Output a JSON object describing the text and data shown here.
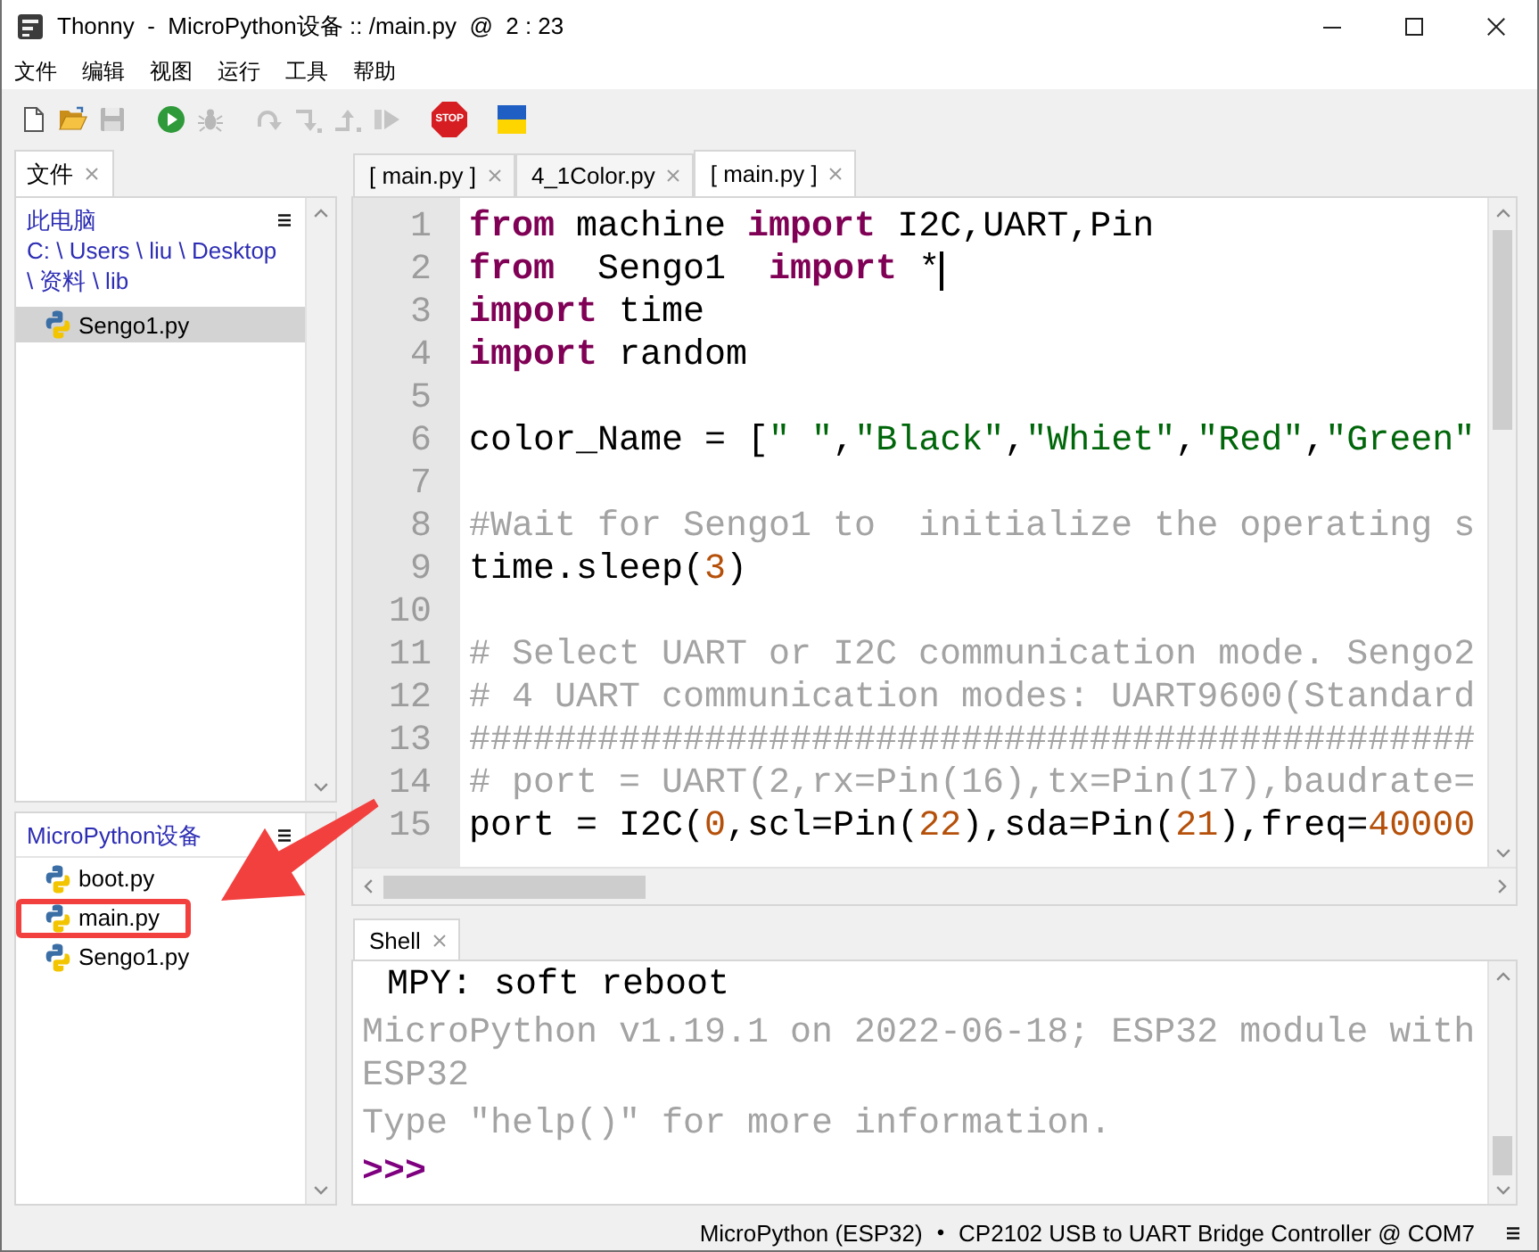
{
  "window": {
    "title": "Thonny  -  MicroPython设备 :: /main.py  @  2 : 23"
  },
  "menu": [
    "文件",
    "编辑",
    "视图",
    "运行",
    "工具",
    "帮助"
  ],
  "toolbar": [
    {
      "buttons": [
        {
          "kind": "new",
          "disabled": false
        },
        {
          "kind": "open",
          "disabled": false
        },
        {
          "kind": "save",
          "disabled": true
        }
      ]
    },
    {
      "buttons": [
        {
          "kind": "run",
          "disabled": false
        },
        {
          "kind": "debug",
          "disabled": true
        }
      ]
    },
    {
      "buttons": [
        {
          "kind": "step_over",
          "disabled": true
        },
        {
          "kind": "step_into",
          "disabled": true
        },
        {
          "kind": "step_out",
          "disabled": true
        },
        {
          "kind": "resume",
          "disabled": true
        }
      ]
    },
    {
      "buttons": [
        {
          "kind": "stop",
          "label": "STOP",
          "disabled": false
        }
      ]
    },
    {
      "buttons": [
        {
          "kind": "flag"
        }
      ]
    }
  ],
  "files_panel": {
    "tab": {
      "label": "文件",
      "selected": true
    },
    "local": {
      "title": "此电脑",
      "path": "C: \\ Users \\ liu \\ Desktop \\ 资料 \\ lib",
      "files": [
        {
          "name": "Sengo1.py",
          "selected": true
        }
      ]
    },
    "device": {
      "title": "MicroPython设备",
      "files": [
        {
          "name": "boot.py",
          "selected": false,
          "highlighted": false
        },
        {
          "name": "main.py",
          "selected": false,
          "highlighted": true
        },
        {
          "name": "Sengo1.py",
          "selected": false,
          "highlighted": false
        }
      ]
    }
  },
  "editor": {
    "tabs": [
      {
        "label": "[ main.py ]",
        "selected": false
      },
      {
        "label": "4_1Color.py",
        "selected": false
      },
      {
        "label": "[ main.py ]",
        "selected": true
      }
    ],
    "lines": [
      {
        "number": "1",
        "cursor": false,
        "tokens": [
          {
            "kind": "keyword",
            "text": "from"
          },
          {
            "kind": "plain",
            "text": " machine "
          },
          {
            "kind": "keyword",
            "text": "import"
          },
          {
            "kind": "plain",
            "text": " I2C,UART,Pin"
          }
        ]
      },
      {
        "number": "2",
        "cursor": true,
        "tokens": [
          {
            "kind": "keyword",
            "text": "from"
          },
          {
            "kind": "plain",
            "text": "  Sengo1  "
          },
          {
            "kind": "keyword",
            "text": "import"
          },
          {
            "kind": "plain",
            "text": " *"
          }
        ]
      },
      {
        "number": "3",
        "cursor": false,
        "tokens": [
          {
            "kind": "keyword",
            "text": "import"
          },
          {
            "kind": "plain",
            "text": " time"
          }
        ]
      },
      {
        "number": "4",
        "cursor": false,
        "tokens": [
          {
            "kind": "keyword",
            "text": "import"
          },
          {
            "kind": "plain",
            "text": " random"
          }
        ]
      },
      {
        "number": "5",
        "cursor": false
      },
      {
        "number": "6",
        "cursor": false,
        "tokens": [
          {
            "kind": "plain",
            "text": "color_Name = ["
          },
          {
            "kind": "string",
            "text": "\" \""
          },
          {
            "kind": "plain",
            "text": ","
          },
          {
            "kind": "string",
            "text": "\"Black\""
          },
          {
            "kind": "plain",
            "text": ","
          },
          {
            "kind": "string",
            "text": "\"Whiet\""
          },
          {
            "kind": "plain",
            "text": ","
          },
          {
            "kind": "string",
            "text": "\"Red\""
          },
          {
            "kind": "plain",
            "text": ","
          },
          {
            "kind": "string",
            "text": "\"Green\""
          }
        ]
      },
      {
        "number": "7",
        "cursor": false
      },
      {
        "number": "8",
        "cursor": false,
        "tokens": [
          {
            "kind": "comment",
            "text": "#Wait for Sengo1 to  initialize the operating s"
          }
        ]
      },
      {
        "number": "9",
        "cursor": false,
        "tokens": [
          {
            "kind": "plain",
            "text": "time.sleep("
          },
          {
            "kind": "number",
            "text": "3"
          },
          {
            "kind": "plain",
            "text": ")"
          }
        ]
      },
      {
        "number": "10",
        "cursor": false
      },
      {
        "number": "11",
        "cursor": false,
        "tokens": [
          {
            "kind": "comment",
            "text": "# Select UART or I2C communication mode. Sengo2"
          }
        ]
      },
      {
        "number": "12",
        "cursor": false,
        "tokens": [
          {
            "kind": "comment",
            "text": "# 4 UART communication modes: UART9600(Standard"
          }
        ]
      },
      {
        "number": "13",
        "cursor": false,
        "tokens": [
          {
            "kind": "comment",
            "text": "###############################################"
          }
        ]
      },
      {
        "number": "14",
        "cursor": false,
        "tokens": [
          {
            "kind": "comment",
            "text": "# port = UART(2,rx=Pin(16),tx=Pin(17),baudrate="
          }
        ]
      },
      {
        "number": "15",
        "cursor": false,
        "tokens": [
          {
            "kind": "plain",
            "text": "port = I2C("
          },
          {
            "kind": "number",
            "text": "0"
          },
          {
            "kind": "plain",
            "text": ",scl=Pin("
          },
          {
            "kind": "number",
            "text": "22"
          },
          {
            "kind": "plain",
            "text": "),sda=Pin("
          },
          {
            "kind": "number",
            "text": "21"
          },
          {
            "kind": "plain",
            "text": "),freq="
          },
          {
            "kind": "number",
            "text": "40000"
          }
        ]
      }
    ]
  },
  "shell": {
    "tab": {
      "label": "Shell",
      "selected": true
    },
    "lines": [
      {
        "kind": "system",
        "text": "MPY: soft reboot"
      },
      {
        "kind": "info",
        "text": "MicroPython v1.19.1 on 2022-06-18; ESP32 module with ESP32"
      },
      {
        "kind": "info",
        "text": "Type \"help()\" for more information."
      },
      {
        "kind": "prompt",
        "text": ">>>"
      }
    ]
  },
  "status_bar": {
    "interpreter": "MicroPython (ESP32)",
    "separator": "•",
    "port": "CP2102 USB to UART Bridge Controller @ COM7"
  }
}
